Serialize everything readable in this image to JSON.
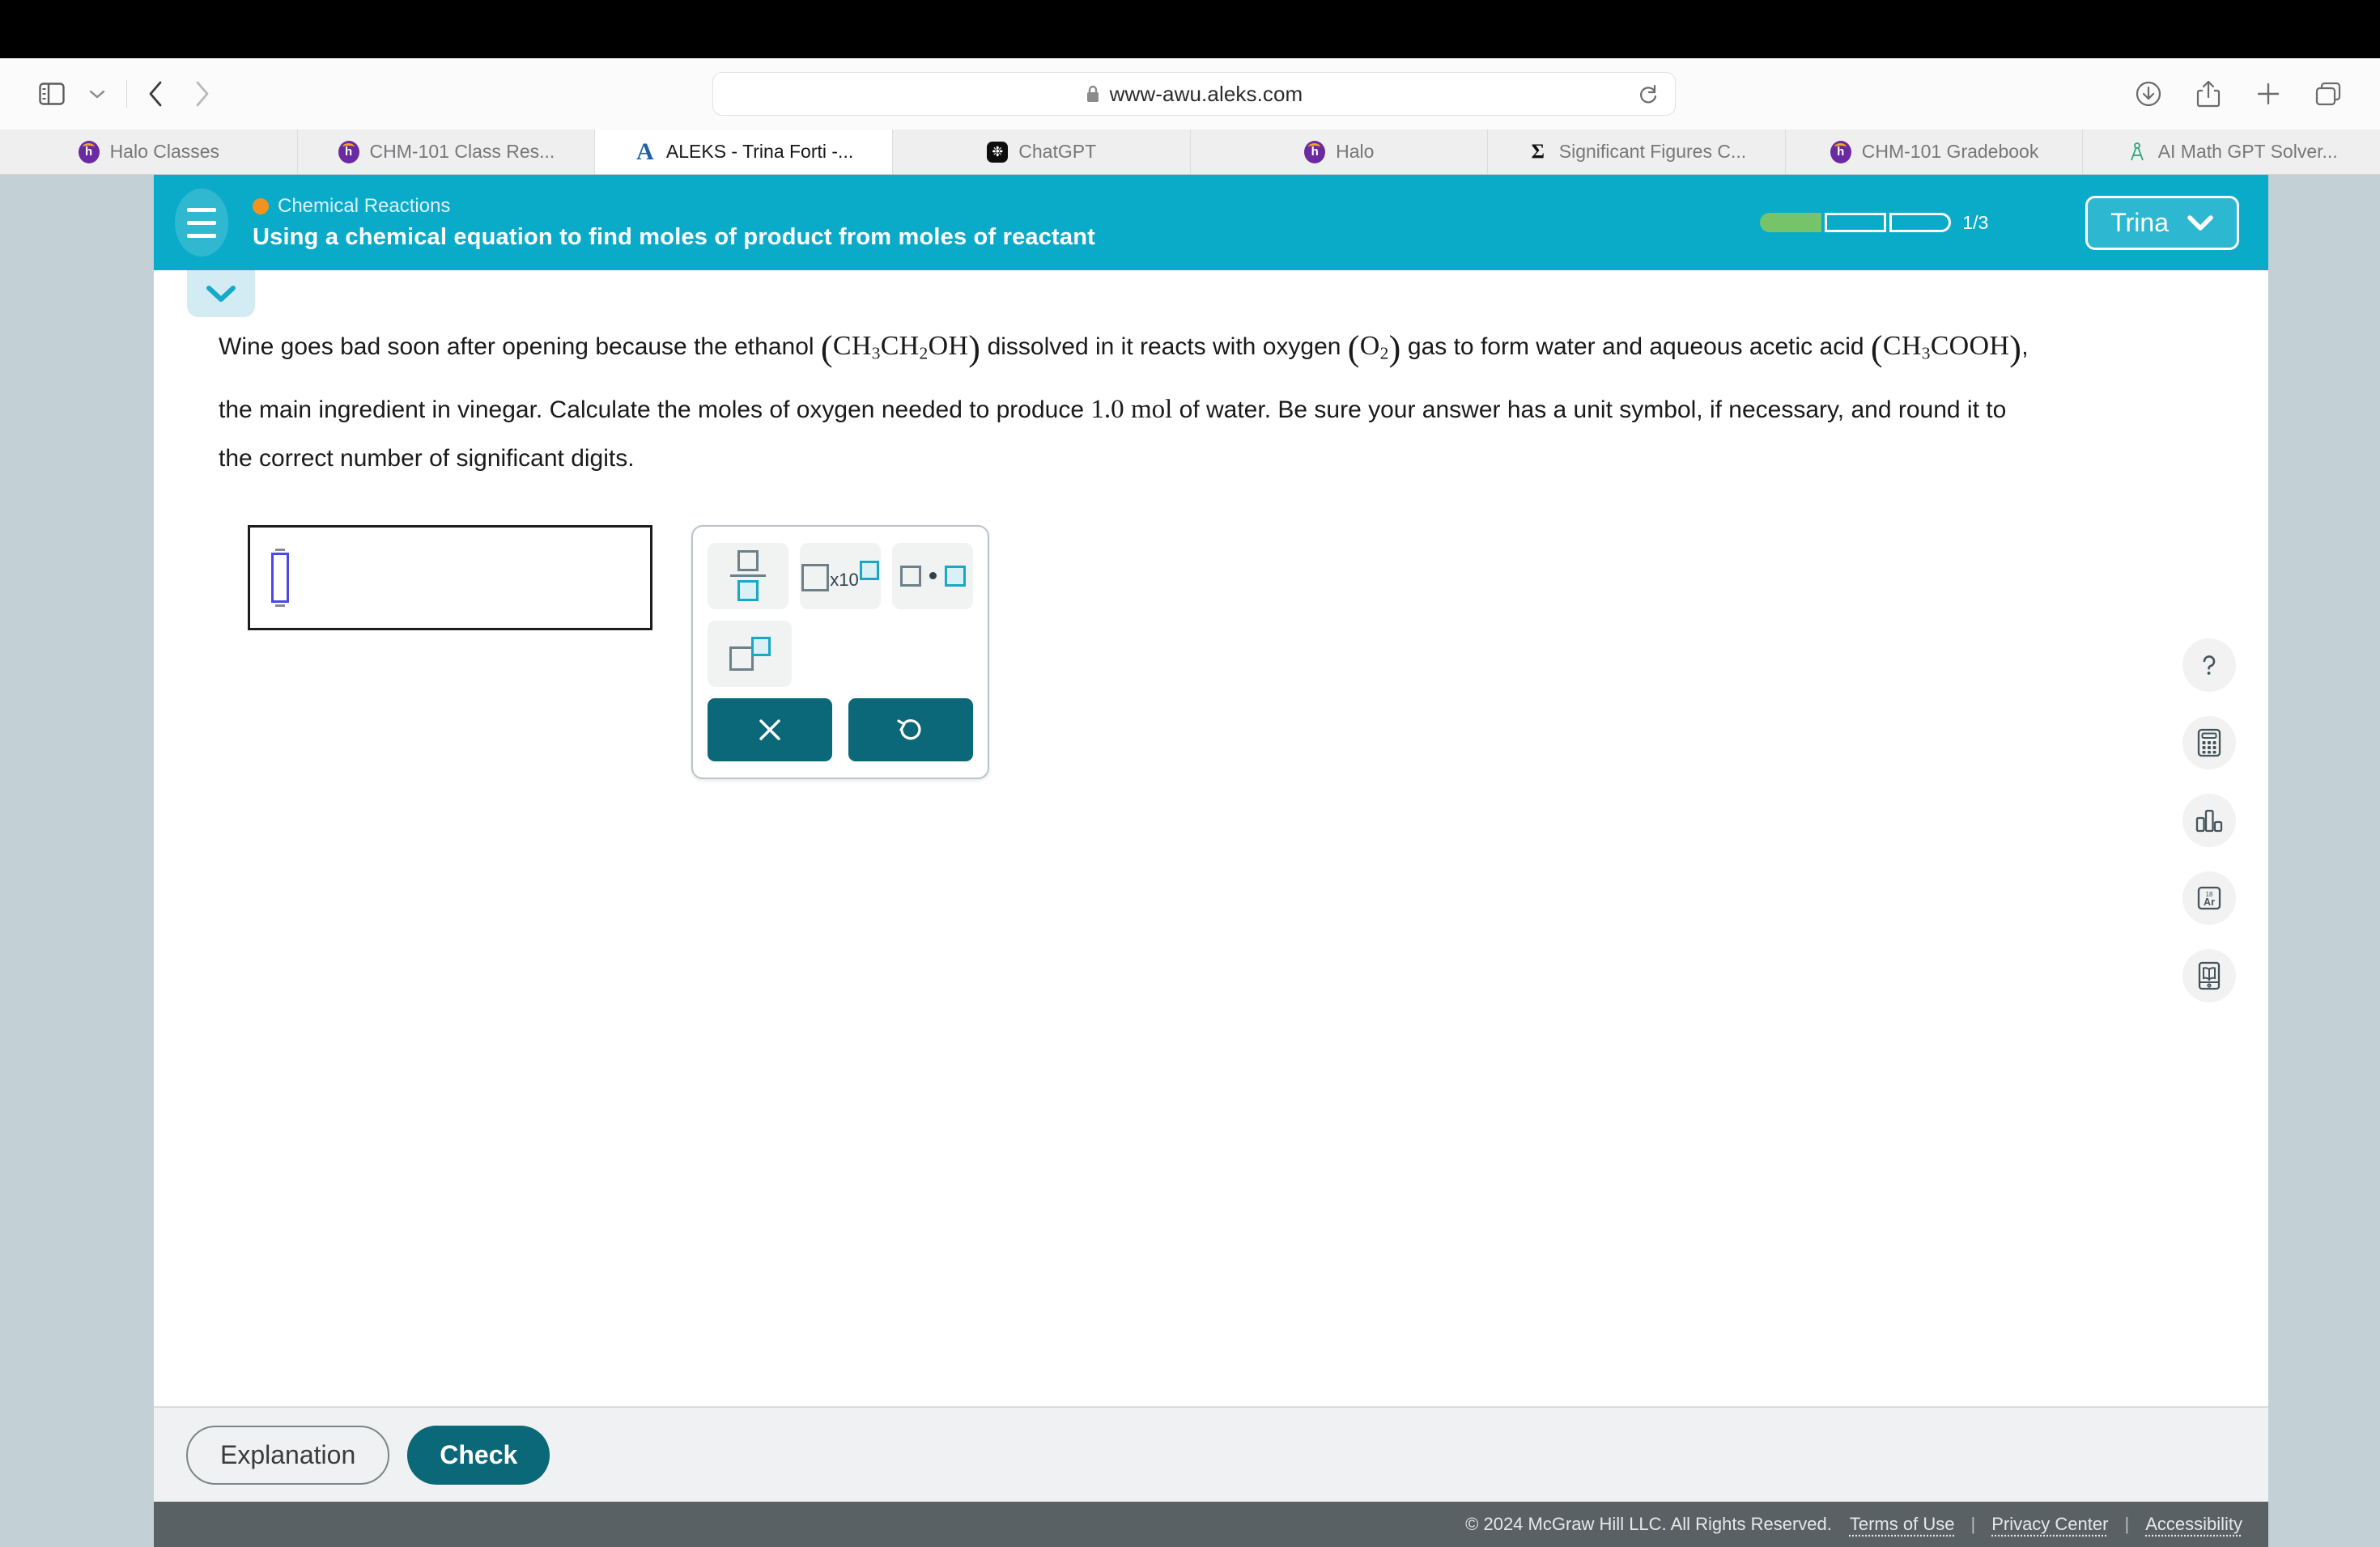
{
  "browser": {
    "url": "www-awu.aleks.com",
    "lock_icon": "lock-icon",
    "sidebar_icon": "sidebar-toggle-icon",
    "back_icon": "back-chevron-icon",
    "forward_icon": "forward-chevron-icon",
    "reload_icon": "reload-icon",
    "downloads_icon": "downloads-icon",
    "share_icon": "share-icon",
    "newtab_icon": "plus-icon",
    "taboverview_icon": "tab-overview-icon",
    "tabs": [
      {
        "label": "Halo Classes",
        "icon": "halo-icon",
        "active": false
      },
      {
        "label": "CHM-101 Class Res...",
        "icon": "halo-icon",
        "active": false
      },
      {
        "label": "ALEKS - Trina Forti -...",
        "icon": "aleks-icon",
        "active": true
      },
      {
        "label": "ChatGPT",
        "icon": "chatgpt-icon",
        "active": false
      },
      {
        "label": "Halo",
        "icon": "halo-icon",
        "active": false
      },
      {
        "label": "Significant Figures C...",
        "icon": "sigma-icon",
        "active": false
      },
      {
        "label": "CHM-101 Gradebook",
        "icon": "halo-icon",
        "active": false
      },
      {
        "label": "AI Math GPT Solver...",
        "icon": "compass-icon",
        "active": false
      }
    ]
  },
  "aleks_header": {
    "menu_icon": "hamburger-icon",
    "topic_dot_color": "#f5921e",
    "topic": "Chemical Reactions",
    "lesson_title": "Using a chemical equation to find moles of product from moles of reactant",
    "progress": {
      "count_label": "1/3",
      "total_segments": 3,
      "filled_segments": 1,
      "fill_color": "#76c36a"
    },
    "user": {
      "name": "Trina",
      "chevron_icon": "chevron-down-icon"
    },
    "bg_color": "#0aabc9"
  },
  "collapse_tab": {
    "icon": "chevron-down-icon"
  },
  "question": {
    "part1": "Wine goes bad soon after opening because the ethanol ",
    "formula1": {
      "open": "(",
      "atoms": "CH3CH2OH",
      "close": ")"
    },
    "part2": " dissolved in it reacts with oxygen ",
    "formula2": {
      "open": "(",
      "atoms": "O2",
      "close": ")"
    },
    "part3": " gas to form water and aqueous acetic acid ",
    "formula3": {
      "open": "(",
      "atoms": "CH3COOH",
      "close": ")"
    },
    "part4": ", the main ingredient in vinegar. Calculate the moles of oxygen needed to produce ",
    "quantity": "1.0",
    "unit": "mol",
    "part5": " of water. Be sure your answer has a unit symbol, if necessary, and round it to the correct number of significant digits."
  },
  "answer_input": {
    "value": "",
    "caret_icon": "text-caret-icon"
  },
  "keypad": {
    "buttons": [
      {
        "name": "fraction-button",
        "label": "fraction"
      },
      {
        "name": "times-ten-power-button",
        "label": "x10"
      },
      {
        "name": "multiply-dot-button",
        "label": "dot-product"
      },
      {
        "name": "superscript-button",
        "label": "superscript"
      }
    ],
    "actions": [
      {
        "name": "clear-button",
        "icon": "close-x-icon",
        "glyph": "✕"
      },
      {
        "name": "undo-button",
        "icon": "undo-icon",
        "glyph": "↺"
      }
    ],
    "x10_label": "x10"
  },
  "tool_rail": [
    {
      "name": "help-tool",
      "icon": "question-mark-icon",
      "label": "?"
    },
    {
      "name": "calculator-tool",
      "icon": "calculator-icon",
      "label": ""
    },
    {
      "name": "chart-tool",
      "icon": "bar-chart-icon",
      "label": ""
    },
    {
      "name": "periodic-table-tool",
      "icon": "periodic-element-icon",
      "label": "Ar",
      "number": "18"
    },
    {
      "name": "glossary-tool",
      "icon": "book-icon",
      "label": ""
    }
  ],
  "actions": {
    "explanation_label": "Explanation",
    "check_label": "Check"
  },
  "footer": {
    "copyright": "© 2024 McGraw Hill LLC. All Rights Reserved.",
    "links": [
      "Terms of Use",
      "Privacy Center",
      "Accessibility"
    ],
    "divider": "|"
  }
}
